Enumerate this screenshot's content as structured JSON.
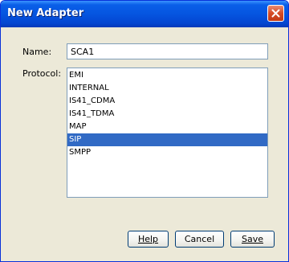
{
  "window": {
    "title": "New Adapter"
  },
  "form": {
    "name_label": "Name:",
    "name_value": "SCA1",
    "protocol_label": "Protocol:",
    "protocols": [
      "EMI",
      "INTERNAL",
      "IS41_CDMA",
      "IS41_TDMA",
      "MAP",
      "SIP",
      "SMPP"
    ],
    "selected_protocol": "SIP"
  },
  "buttons": {
    "help_label": "Help",
    "cancel_label": "Cancel",
    "save_label": "Save"
  },
  "colors": {
    "titlebar": "#0555e0",
    "selection": "#316ac5",
    "dialog_bg": "#ece9d8",
    "close_button": "#d54b25"
  },
  "icons": {
    "close": "close-icon"
  }
}
